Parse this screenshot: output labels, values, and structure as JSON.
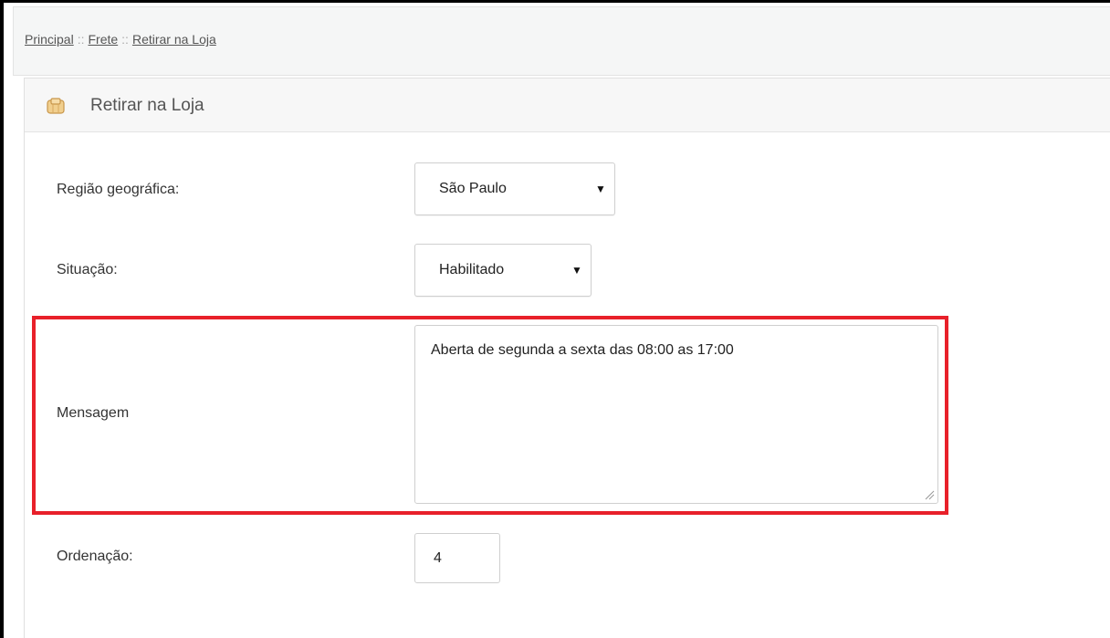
{
  "breadcrumb": {
    "items": [
      "Principal",
      "Frete",
      "Retirar na Loja"
    ],
    "separator": "::"
  },
  "panel": {
    "title": "Retirar na Loja",
    "icon": "box-icon"
  },
  "form": {
    "regiao": {
      "label": "Região geográfica:",
      "value": "São Paulo"
    },
    "situacao": {
      "label": "Situação:",
      "value": "Habilitado"
    },
    "mensagem": {
      "label": "Mensagem",
      "value": "Aberta de segunda a sexta das 08:00 as 17:00"
    },
    "ordenacao": {
      "label": "Ordenação:",
      "value": "4"
    }
  },
  "colors": {
    "highlight": "#e8202a",
    "breadcrumb_bg": "#f5f6f6",
    "header_bg": "#f7f7f7"
  }
}
